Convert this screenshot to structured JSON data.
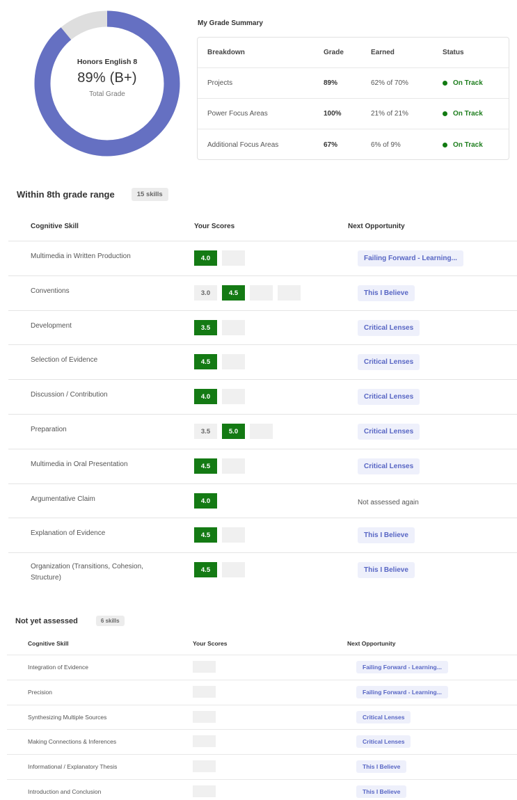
{
  "grade": {
    "course": "Honors English 8",
    "display": "89% (B+)",
    "subtitle": "Total Grade",
    "percent": 89,
    "ring_color": "#6570c2",
    "track_color": "#dedede"
  },
  "summary": {
    "title": "My Grade Summary",
    "headers": {
      "breakdown": "Breakdown",
      "grade": "Grade",
      "earned": "Earned",
      "status": "Status"
    },
    "rows": [
      {
        "breakdown": "Projects",
        "grade": "89%",
        "earned": "62% of 70%",
        "status": "On Track"
      },
      {
        "breakdown": "Power Focus Areas",
        "grade": "100%",
        "earned": "21% of 21%",
        "status": "On Track"
      },
      {
        "breakdown": "Additional Focus Areas",
        "grade": "67%",
        "earned": "6% of 9%",
        "status": "On Track"
      }
    ]
  },
  "within": {
    "title": "Within 8th grade range",
    "count": "15 skills",
    "headers": {
      "skill": "Cognitive Skill",
      "scores": "Your Scores",
      "next": "Next Opportunity"
    },
    "rows": [
      {
        "skill": "Multimedia in Written Production",
        "prior": [],
        "current": "4.0",
        "empties": 1,
        "next": "Failing Forward - Learning...",
        "next_is_link": true
      },
      {
        "skill": "Conventions",
        "prior": [
          "3.0"
        ],
        "current": "4.5",
        "empties": 2,
        "next": "This I Believe",
        "next_is_link": true
      },
      {
        "skill": "Development",
        "prior": [],
        "current": "3.5",
        "empties": 1,
        "next": "Critical Lenses",
        "next_is_link": true
      },
      {
        "skill": "Selection of Evidence",
        "prior": [],
        "current": "4.5",
        "empties": 1,
        "next": "Critical Lenses",
        "next_is_link": true
      },
      {
        "skill": "Discussion / Contribution",
        "prior": [],
        "current": "4.0",
        "empties": 1,
        "next": "Critical Lenses",
        "next_is_link": true
      },
      {
        "skill": "Preparation",
        "prior": [
          "3.5"
        ],
        "current": "5.0",
        "empties": 1,
        "next": "Critical Lenses",
        "next_is_link": true
      },
      {
        "skill": "Multimedia in Oral Presentation",
        "prior": [],
        "current": "4.5",
        "empties": 1,
        "next": "Critical Lenses",
        "next_is_link": true
      },
      {
        "skill": "Argumentative Claim",
        "prior": [],
        "current": "4.0",
        "empties": 0,
        "next": "Not assessed again",
        "next_is_link": false
      },
      {
        "skill": "Explanation of Evidence",
        "prior": [],
        "current": "4.5",
        "empties": 1,
        "next": "This I Believe",
        "next_is_link": true
      },
      {
        "skill": "Organization (Transitions, Cohesion, Structure)",
        "prior": [],
        "current": "4.5",
        "empties": 1,
        "next": "This I Believe",
        "next_is_link": true
      }
    ]
  },
  "notyet": {
    "title": "Not yet assessed",
    "count": "6 skills",
    "headers": {
      "skill": "Cognitive Skill",
      "scores": "Your Scores",
      "next": "Next Opportunity"
    },
    "rows": [
      {
        "skill": "Integration of Evidence",
        "next": "Failing Forward - Learning..."
      },
      {
        "skill": "Precision",
        "next": "Failing Forward - Learning..."
      },
      {
        "skill": "Synthesizing Multiple Sources",
        "next": "Critical Lenses"
      },
      {
        "skill": "Making Connections & Inferences",
        "next": "Critical Lenses"
      },
      {
        "skill": "Informational / Explanatory Thesis",
        "next": "This I Believe"
      },
      {
        "skill": "Introduction and Conclusion",
        "next": "This I Believe"
      }
    ]
  }
}
